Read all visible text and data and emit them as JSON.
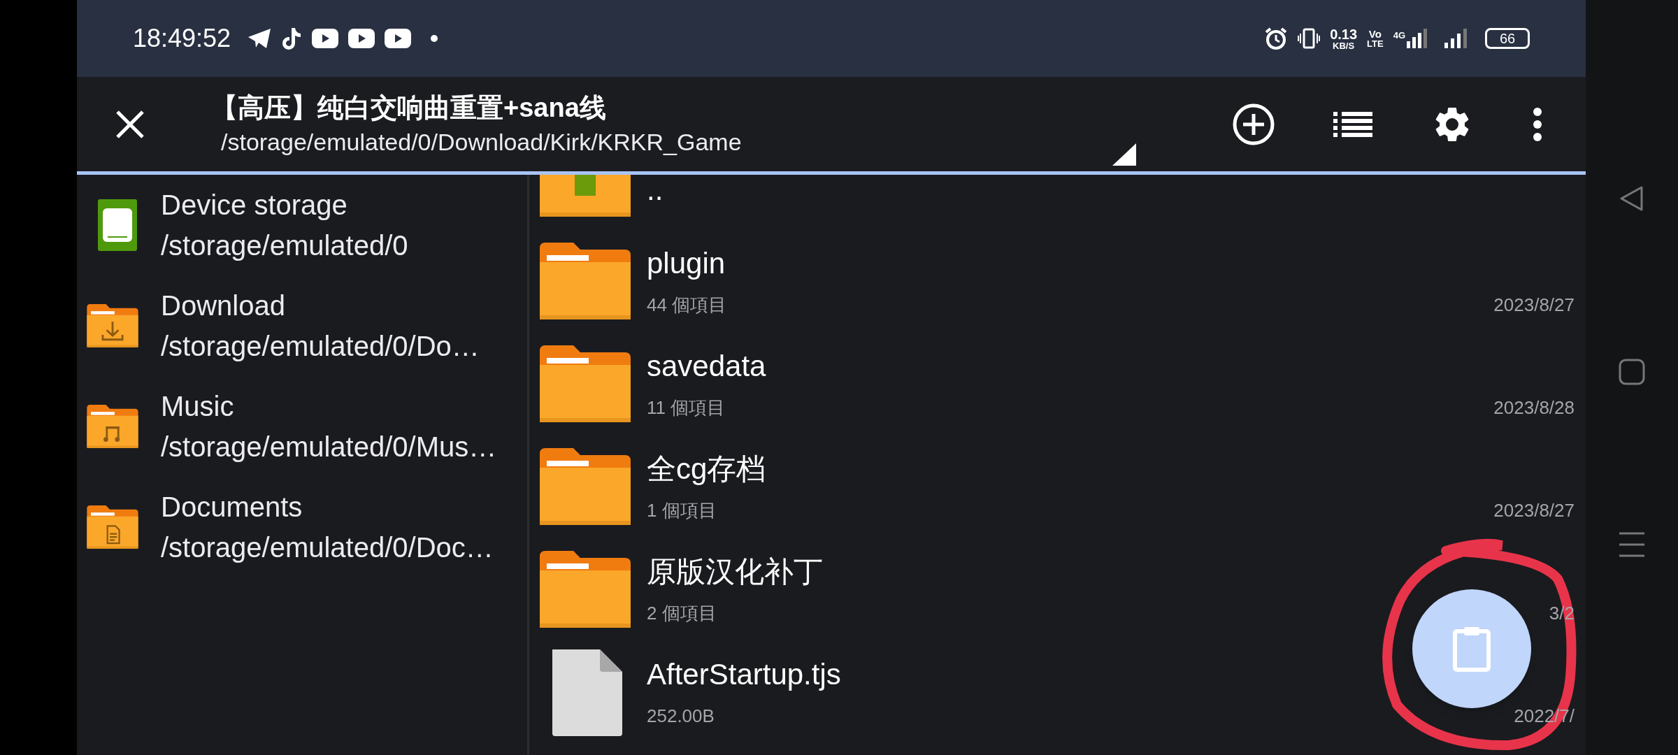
{
  "status_bar": {
    "time": "18:49:52",
    "network_speed": "0.13",
    "network_speed_unit": "KB/S",
    "volte_top": "Vo",
    "volte_bottom": "LTE",
    "network_type": "4G",
    "battery": "66"
  },
  "toolbar": {
    "title": "【高压】纯白交响曲重置+sana线",
    "path": "/storage/emulated/0/Download/Kirk/KRKR_Game"
  },
  "sidebar": {
    "items": [
      {
        "kind": "storage",
        "name": "Device storage",
        "path": "/storage/emulated/0"
      },
      {
        "kind": "download",
        "name": "Download",
        "path": "/storage/emulated/0/Do…"
      },
      {
        "kind": "music",
        "name": "Music",
        "path": "/storage/emulated/0/Mus…"
      },
      {
        "kind": "documents",
        "name": "Documents",
        "path": "/storage/emulated/0/Doc…"
      }
    ]
  },
  "files": [
    {
      "kind": "parent",
      "name": ".."
    },
    {
      "kind": "folder",
      "name": "plugin",
      "info": "44 個項目",
      "date": "2023/8/27"
    },
    {
      "kind": "folder",
      "name": "savedata",
      "info": "11 個項目",
      "date": "2023/8/28"
    },
    {
      "kind": "folder",
      "name": "全cg存档",
      "info": "1 個項目",
      "date": "2023/8/27"
    },
    {
      "kind": "folder",
      "name": "原版汉化补丁",
      "info": "2 個項目",
      "date": "3/2"
    },
    {
      "kind": "file",
      "name": "AfterStartup.tjs",
      "info": "252.00B",
      "date": "2022/7/"
    }
  ]
}
